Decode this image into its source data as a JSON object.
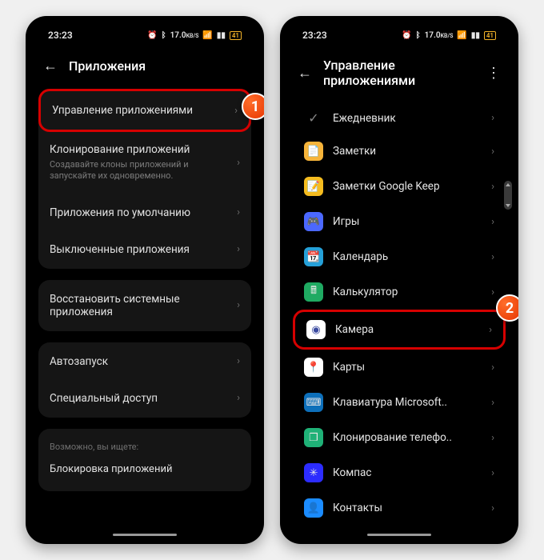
{
  "status": {
    "time": "23:23",
    "net": "17.0",
    "netUnit": "KB/S",
    "battery": "41"
  },
  "badges": {
    "one": "1",
    "two": "2"
  },
  "left": {
    "title": "Приложения",
    "rows": {
      "manage": "Управление приложениями",
      "clone": "Клонирование приложений",
      "cloneSub": "Создавайте клоны приложений и запускайте их одновременно.",
      "default": "Приложения по умолчанию",
      "disabled": "Выключенные приложения",
      "restore": "Восстановить системные приложения",
      "autostart": "Автозапуск",
      "special": "Специальный доступ"
    },
    "hint": {
      "label": "Возможно, вы ищете:",
      "item": "Блокировка приложений"
    }
  },
  "right": {
    "title": "Управление приложениями",
    "apps": [
      {
        "label": "Ежедневник",
        "bg": "transparent",
        "glyphType": "check"
      },
      {
        "label": "Заметки",
        "bg": "#f6b43a",
        "glyph": "📄"
      },
      {
        "label": "Заметки Google Keep",
        "bg": "#f5bc1f",
        "glyph": "📝"
      },
      {
        "label": "Игры",
        "bg": "#4b68ff",
        "glyph": "🎮"
      },
      {
        "label": "Календарь",
        "bg": "#25a0d8",
        "glyph": "📆"
      },
      {
        "label": "Калькулятор",
        "bg": "#1faa62",
        "glyph": "🖩"
      },
      {
        "label": "Камера",
        "bg": "#ffffff",
        "glyph": "◉",
        "glyphColor": "#3a4aa0"
      },
      {
        "label": "Карты",
        "bg": "#ffffff",
        "glyph": "📍"
      },
      {
        "label": "Клавиатура Microsoft..",
        "bg": "#0d6fba",
        "glyph": "⌨"
      },
      {
        "label": "Клонирование телефо..",
        "bg": "#1fb177",
        "glyph": "❐"
      },
      {
        "label": "Компас",
        "bg": "#2c2cff",
        "glyph": "✳"
      },
      {
        "label": "Контакты",
        "bg": "#1b8cff",
        "glyph": "👤"
      }
    ]
  }
}
